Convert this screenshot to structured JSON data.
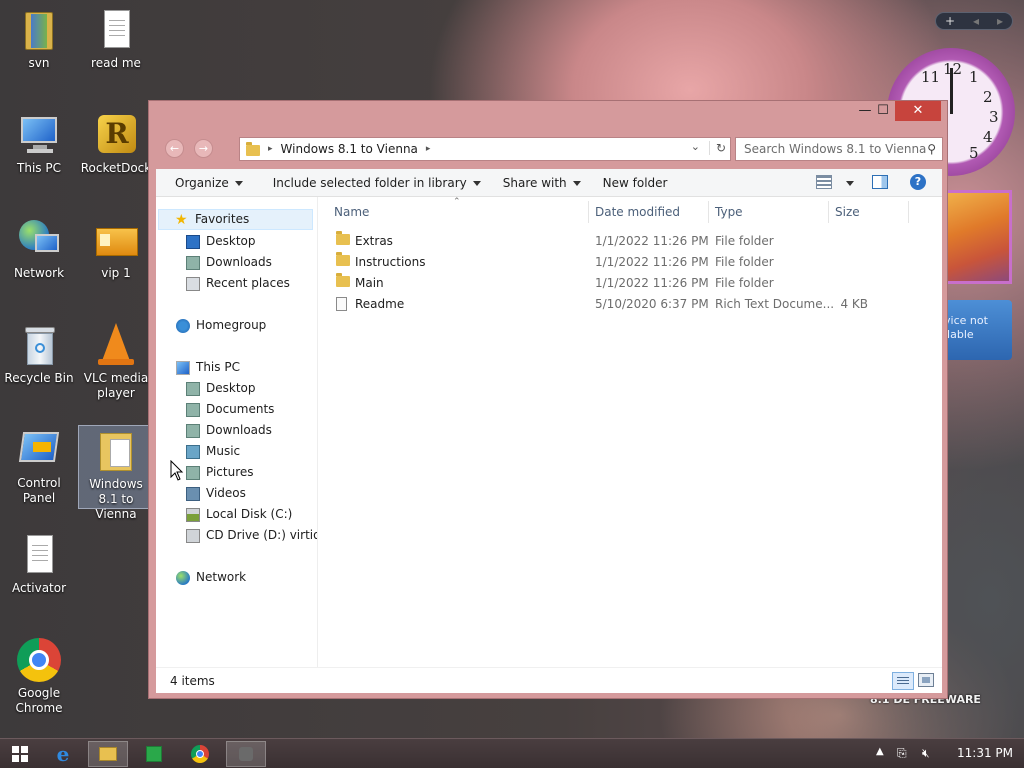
{
  "desktop": {
    "icons": [
      {
        "label": "svn",
        "icon": "folder-svn-icon"
      },
      {
        "label": "read me",
        "icon": "text-document-icon"
      },
      {
        "label": "This PC",
        "icon": "computer-icon"
      },
      {
        "label": "RocketDock",
        "icon": "rocketdock-icon"
      },
      {
        "label": "Network",
        "icon": "network-globe-icon"
      },
      {
        "label": "vip 1",
        "icon": "vip-card-icon"
      },
      {
        "label": "Recycle Bin",
        "icon": "recycle-bin-icon"
      },
      {
        "label": "VLC media player",
        "icon": "vlc-cone-icon"
      },
      {
        "label": "Control Panel",
        "icon": "control-panel-icon"
      },
      {
        "label": "Windows 8.1 to Vienna",
        "icon": "folder-document-icon"
      },
      {
        "label": "Activator",
        "icon": "text-document-icon"
      },
      {
        "label": "Google Chrome",
        "icon": "chrome-icon"
      }
    ],
    "gadgets": {
      "clock_numbers": [
        "12",
        "1",
        "2",
        "3",
        "4",
        "5",
        "11"
      ],
      "weather_text": "vice not\nilable",
      "watermark": "8.1 DE FREEWARE"
    }
  },
  "explorer": {
    "window_controls": {
      "minimize": "—",
      "maximize": "☐",
      "close": "✕"
    },
    "address": {
      "path": "Windows 8.1 to Vienna"
    },
    "search": {
      "placeholder": "Search Windows 8.1 to Vienna"
    },
    "toolbar": {
      "organize": "Organize",
      "include_library": "Include selected folder in library",
      "share_with": "Share with",
      "new_folder": "New folder"
    },
    "nav": {
      "favorites": "Favorites",
      "fav_items": [
        "Desktop",
        "Downloads",
        "Recent places"
      ],
      "homegroup": "Homegroup",
      "this_pc": "This PC",
      "pc_items": [
        "Desktop",
        "Documents",
        "Downloads",
        "Music",
        "Pictures",
        "Videos",
        "Local Disk (C:)",
        "CD Drive (D:) virtio-w"
      ],
      "network": "Network"
    },
    "columns": {
      "name": "Name",
      "date": "Date modified",
      "type": "Type",
      "size": "Size"
    },
    "files": [
      {
        "name": "Extras",
        "date": "1/1/2022 11:26 PM",
        "type": "File folder",
        "size": "",
        "icon": "folder-icon"
      },
      {
        "name": "Instructions",
        "date": "1/1/2022 11:26 PM",
        "type": "File folder",
        "size": "",
        "icon": "folder-icon"
      },
      {
        "name": "Main",
        "date": "1/1/2022 11:26 PM",
        "type": "File folder",
        "size": "",
        "icon": "folder-icon"
      },
      {
        "name": "Readme",
        "date": "5/10/2020 6:37 PM",
        "type": "Rich Text Docume...",
        "size": "4 KB",
        "icon": "rtf-document-icon"
      }
    ],
    "status": {
      "items": "4 items"
    }
  },
  "taskbar": {
    "buttons": [
      "start-icon",
      "internet-explorer-icon",
      "file-explorer-icon",
      "store-icon",
      "chrome-icon",
      "tool-icon"
    ],
    "clock": "11:31 PM"
  },
  "colors": {
    "window_frame": "#d59a9c",
    "close_button": "#c7443d",
    "selection": "#e5f1fb"
  }
}
